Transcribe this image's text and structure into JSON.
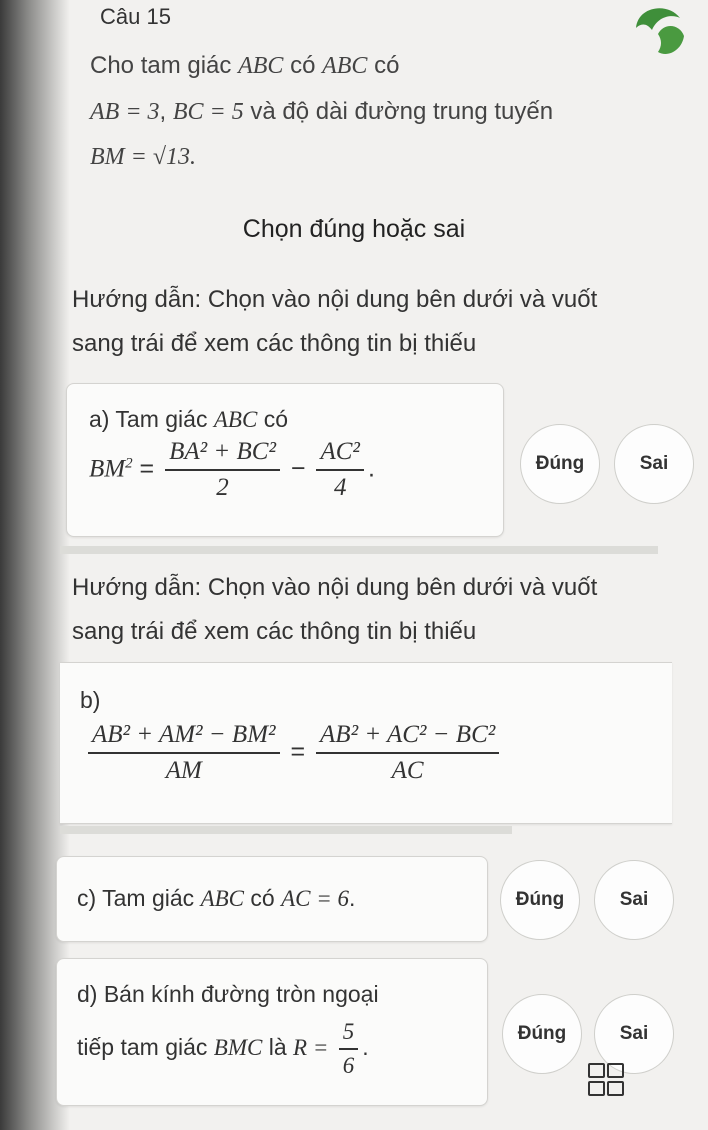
{
  "question": {
    "title": "Câu 15",
    "prompt_line1_text": "Cho tam giác",
    "prompt_line1_math1": "ABC",
    "prompt_line1_mid": "có",
    "prompt_line1_math2": "ABC",
    "prompt_line1_end": "có",
    "prompt_line2_math1": "AB = 3",
    "prompt_line2_sep": ",",
    "prompt_line2_math2": "BC = 5",
    "prompt_line2_text": "và độ dài đường trung tuyến",
    "prompt_line3_math": "BM = √13."
  },
  "instruction": "Chọn đúng hoặc sai",
  "hints": {
    "hint1_line1": "Hướng dẫn: Chọn vào nội dung bên dưới và vuốt",
    "hint1_line2": "sang trái để xem các thông tin bị thiếu",
    "hint2_line1": "Hướng dẫn: Chọn vào nội dung bên dưới và vuốt",
    "hint2_line2": "sang trái để xem các thông tin bị thiếu"
  },
  "items": {
    "a": {
      "label": "a) Tam giác",
      "label_math": "ABC",
      "label_end": "có",
      "lhs": "BM",
      "frac1_num": "BA² + BC²",
      "frac1_den": "2",
      "minus": "−",
      "frac2_num": "AC²",
      "frac2_den": "4",
      "tail": ".",
      "true_label": "Đúng",
      "false_label": "Sai"
    },
    "b": {
      "label": "b)",
      "frac1_num": "AB² + AM² − BM²",
      "frac1_den": "AM",
      "equals": "=",
      "frac2_num": "AB² + AC² − BC²",
      "frac2_den": "AC"
    },
    "c": {
      "label": "c) Tam giác",
      "label_math": "ABC",
      "label_mid": "có",
      "math": "AC = 6",
      "tail": ".",
      "true_label": "Đúng",
      "false_label": "Sai"
    },
    "d": {
      "line1": "d) Bán kính đường tròn ngoại",
      "line2": "tiếp tam giác",
      "line2_math": "BMC",
      "line2_mid": "là",
      "lhs": "R =",
      "frac_num": "5",
      "frac_den": "6",
      "tail": ".",
      "true_label": "Đúng",
      "false_label": "Sai"
    }
  },
  "colors": {
    "background": "#f2f1ef",
    "card": "#fbfbfa",
    "text": "#2b2b2b",
    "logo_green": "#3f8f3a"
  },
  "icons": {
    "logo": "leaf-logo-icon",
    "menu": "grid-menu-icon"
  }
}
